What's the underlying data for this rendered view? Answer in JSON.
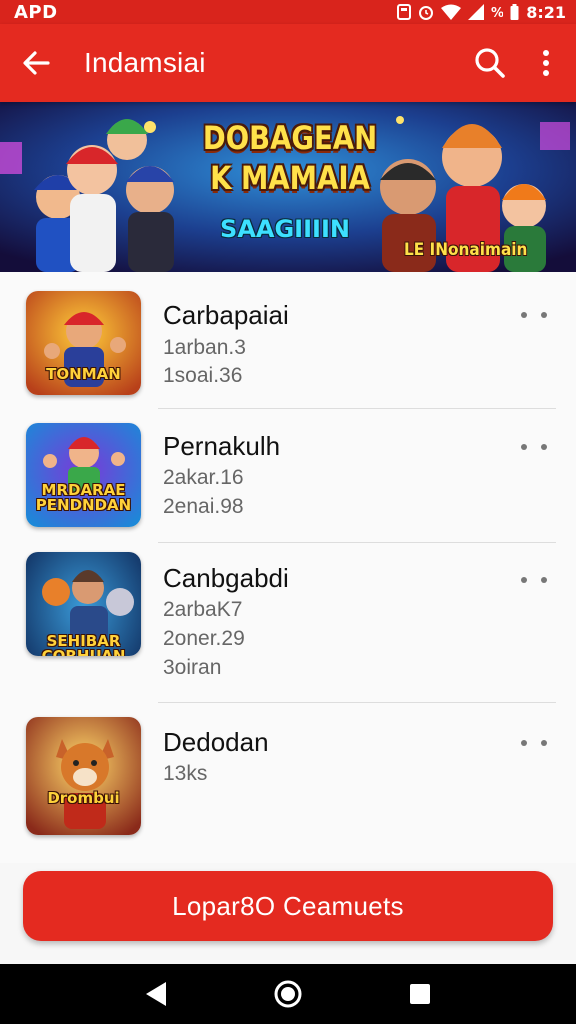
{
  "status_bar": {
    "left_text": "APD",
    "right_text": "8:21",
    "icons": [
      "notification-icon",
      "alarm-icon",
      "wifi-icon",
      "signal-icon",
      "battery-icon"
    ]
  },
  "app_bar": {
    "title": "Indamsiai",
    "icons": [
      "back-arrow-icon",
      "search-icon",
      "more-vert-icon"
    ]
  },
  "banner": {
    "title_line1": "DOBAGEAN",
    "title_line2": "K MAMAIA",
    "subtitle": "SAAGIIIIN",
    "tag": "LE INonaimain"
  },
  "list": {
    "items": [
      {
        "title": "Carbapaiai",
        "lines": [
          "1arban.3",
          "1soai.36"
        ],
        "thumb_label": "TONMAN"
      },
      {
        "title": "Pernakulh",
        "lines": [
          "2akar.16",
          "2enai.98"
        ],
        "thumb_label": "MRDARAE PENDNDAN"
      },
      {
        "title": "Canbgabdi",
        "lines": [
          "2arbaK7",
          "2oner.29",
          "3oiran"
        ],
        "thumb_label": "SEHIBAR CORHUAN"
      },
      {
        "title": "Dedodan",
        "lines": [
          "13ks"
        ],
        "thumb_label": "Drombui"
      }
    ]
  },
  "cta": {
    "label": "Lopar8O Ceamuets"
  },
  "nav_bar": {
    "icons": [
      "back-triangle-icon",
      "home-circle-icon",
      "recents-square-icon"
    ]
  },
  "colors": {
    "primary": "#e42a20",
    "status_bar": "#d9241c",
    "background": "#fafafa",
    "nav": "#000000"
  }
}
